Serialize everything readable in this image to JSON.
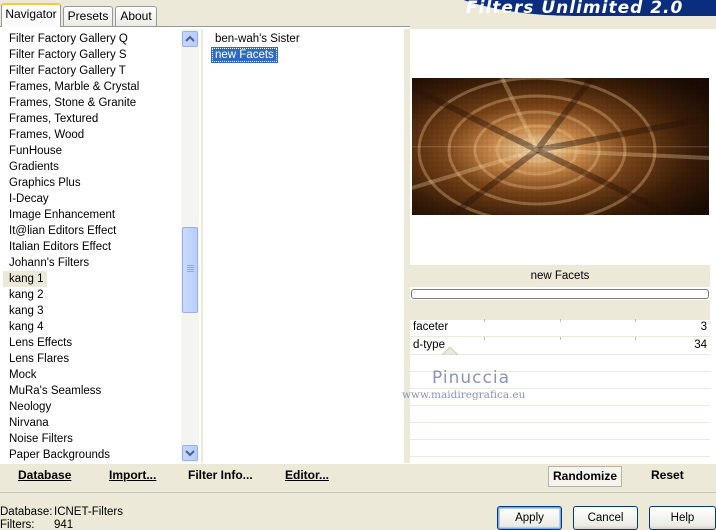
{
  "tabs": [
    {
      "label": "Navigator"
    },
    {
      "label": "Presets"
    },
    {
      "label": "About"
    }
  ],
  "header": {
    "title": "Filters Unlimited 2.0"
  },
  "categories": [
    {
      "label": "Filter Factory Gallery Q"
    },
    {
      "label": "Filter Factory Gallery S"
    },
    {
      "label": "Filter Factory Gallery T"
    },
    {
      "label": "Frames, Marble & Crystal"
    },
    {
      "label": "Frames, Stone & Granite"
    },
    {
      "label": "Frames, Textured"
    },
    {
      "label": "Frames, Wood"
    },
    {
      "label": "FunHouse"
    },
    {
      "label": "Gradients"
    },
    {
      "label": "Graphics Plus"
    },
    {
      "label": "I-Decay"
    },
    {
      "label": "Image Enhancement"
    },
    {
      "label": "It@lian Editors Effect"
    },
    {
      "label": "Italian Editors Effect"
    },
    {
      "label": "Johann's Filters"
    },
    {
      "label": "kang 1"
    },
    {
      "label": "kang 2"
    },
    {
      "label": "kang 3"
    },
    {
      "label": "kang 4"
    },
    {
      "label": "Lens Effects"
    },
    {
      "label": "Lens Flares"
    },
    {
      "label": "Mock"
    },
    {
      "label": "MuRa's Seamless"
    },
    {
      "label": "Neology"
    },
    {
      "label": "Nirvana"
    },
    {
      "label": "Noise Filters"
    },
    {
      "label": "Paper Backgrounds"
    }
  ],
  "selected_category": "kang 1",
  "filters": [
    {
      "label": "ben-wah's Sister"
    },
    {
      "label": "new Facets"
    }
  ],
  "selected_filter": "new Facets",
  "preview": {
    "filter_name": "new Facets"
  },
  "params": [
    {
      "name": "faceter",
      "value": "3"
    },
    {
      "name": "d-type",
      "value": "34"
    }
  ],
  "watermark": {
    "name": "Pinuccia",
    "url": "www.maidiregrafica.eu"
  },
  "toolbar": {
    "database": "Database",
    "import": "Import...",
    "filter_info": "Filter Info...",
    "editor": "Editor...",
    "randomize": "Randomize",
    "reset": "Reset"
  },
  "status": {
    "database_label": "Database:",
    "database_value": "ICNET-Filters",
    "filters_label": "Filters:",
    "filters_value": "941"
  },
  "buttons": {
    "apply": "Apply",
    "cancel": "Cancel",
    "help": "Help"
  },
  "colors": {
    "dialog_bg": "#ece9d8",
    "selection": "#316ac5",
    "banner": "#0a2e8c",
    "preview_dark": "#2a1506",
    "preview_light": "#f2d6a8"
  },
  "icons": {
    "scroll_up": "chevron-up-icon",
    "scroll_down": "chevron-down-icon"
  }
}
